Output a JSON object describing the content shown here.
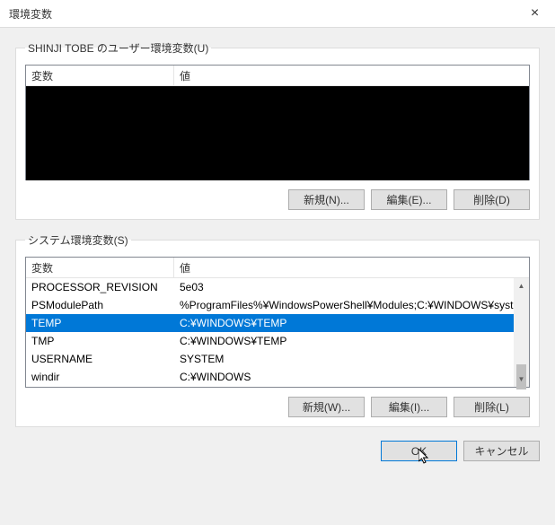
{
  "window": {
    "title": "環境変数",
    "close_icon": "×"
  },
  "user_section": {
    "legend": "SHINJI TOBE のユーザー環境変数(U)",
    "header_var": "変数",
    "header_val": "値",
    "buttons": {
      "new": "新規(N)...",
      "edit": "編集(E)...",
      "delete": "削除(D)"
    }
  },
  "system_section": {
    "legend": "システム環境変数(S)",
    "header_var": "変数",
    "header_val": "値",
    "rows": [
      {
        "var": "PROCESSOR_REVISION",
        "val": "5e03",
        "selected": false
      },
      {
        "var": "PSModulePath",
        "val": "%ProgramFiles%¥WindowsPowerShell¥Modules;C:¥WINDOWS¥syst...",
        "selected": false
      },
      {
        "var": "TEMP",
        "val": "C:¥WINDOWS¥TEMP",
        "selected": true
      },
      {
        "var": "TMP",
        "val": "C:¥WINDOWS¥TEMP",
        "selected": false
      },
      {
        "var": "USERNAME",
        "val": "SYSTEM",
        "selected": false
      },
      {
        "var": "windir",
        "val": "C:¥WINDOWS",
        "selected": false
      }
    ],
    "buttons": {
      "new": "新規(W)...",
      "edit": "編集(I)...",
      "delete": "削除(L)"
    }
  },
  "footer": {
    "ok": "OK",
    "cancel": "キャンセル"
  },
  "scroll": {
    "up": "▲",
    "down": "▼"
  }
}
